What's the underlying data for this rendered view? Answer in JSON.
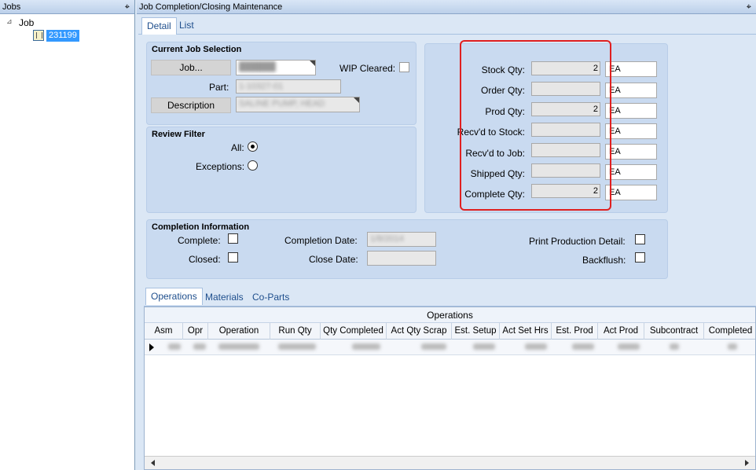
{
  "jobs_pane": {
    "title": "Jobs",
    "pin_glyph": "⌖",
    "tree": {
      "expander": "⊿",
      "root_label": "Job",
      "child_label": "231199"
    }
  },
  "main": {
    "title": "Job Completion/Closing Maintenance",
    "tabs": [
      "Detail",
      "List"
    ],
    "current_job": {
      "title": "Current Job Selection",
      "job_button": "Job...",
      "job_value": "██████",
      "wip_cleared_label": "WIP Cleared:",
      "part_label": "Part:",
      "part_value": "1-10327-01",
      "description_button": "Description",
      "description_value": "SALINE PUMP, HEAD"
    },
    "review_filter": {
      "title": "Review Filter",
      "all_label": "All:",
      "exceptions_label": "Exceptions:"
    },
    "quantities": [
      {
        "label": "Stock Qty:",
        "value": "2",
        "uom": "EA"
      },
      {
        "label": "Order Qty:",
        "value": "",
        "uom": "EA"
      },
      {
        "label": "Prod Qty:",
        "value": "2",
        "uom": "EA"
      },
      {
        "label": "Recv'd to Stock:",
        "value": "",
        "uom": "EA"
      },
      {
        "label": "Recv'd to Job:",
        "value": "",
        "uom": "EA"
      },
      {
        "label": "Shipped Qty:",
        "value": "",
        "uom": "EA"
      },
      {
        "label": "Complete Qty:",
        "value": "2",
        "uom": "EA"
      }
    ],
    "completion": {
      "title": "Completion Information",
      "complete_label": "Complete:",
      "closed_label": "Closed:",
      "completion_date_label": "Completion Date:",
      "completion_date_value": "1/8/2014",
      "close_date_label": "Close Date:",
      "close_date_value": "",
      "print_production_detail_label": "Print Production Detail:",
      "backflush_label": "Backflush:"
    },
    "bottom_tabs": [
      "Operations",
      "Materials",
      "Co-Parts"
    ],
    "grid": {
      "caption": "Operations",
      "columns": [
        "Asm",
        "Opr",
        "Operation",
        "Run Qty",
        "Qty Completed",
        "Act Qty Scrap",
        "Est. Setup",
        "Act Set Hrs",
        "Est. Prod",
        "Act Prod",
        "Subcontract",
        "Completed"
      ]
    }
  },
  "colors": {
    "highlight_border": "#e02020",
    "selection": "#3399ff",
    "group_background": "#c9daf0"
  }
}
